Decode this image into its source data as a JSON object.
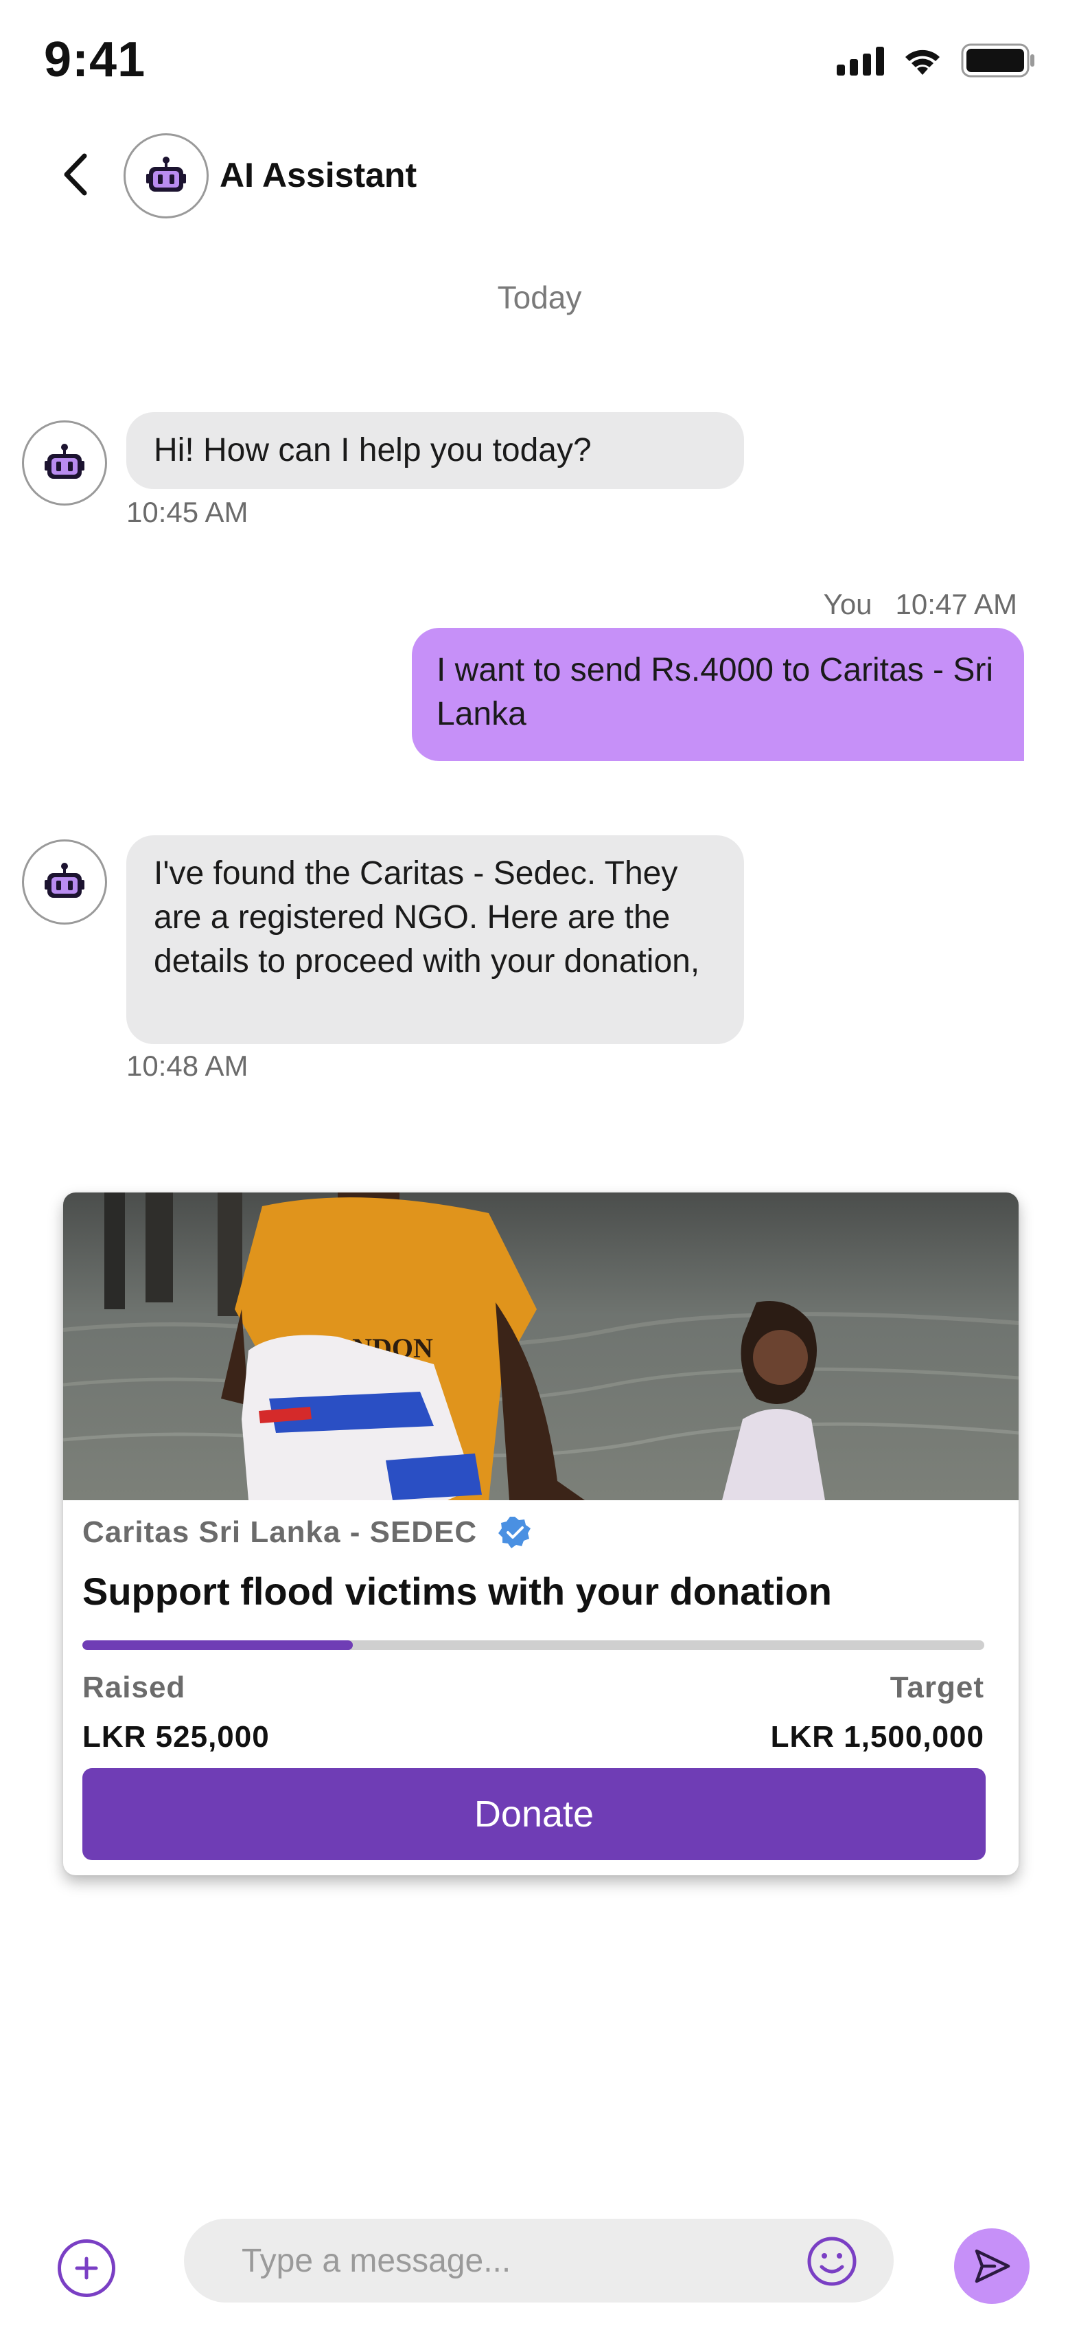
{
  "status_bar": {
    "time": "9:41"
  },
  "header": {
    "title": "AI Assistant"
  },
  "date_separator": "Today",
  "messages": [
    {
      "sender": "bot",
      "text": "Hi! How can I help you today?",
      "time": "10:45 AM"
    },
    {
      "sender": "user",
      "sender_label": "You",
      "text": "I want to send Rs.4000 to Caritas - Sri Lanka",
      "time": "10:47 AM"
    },
    {
      "sender": "bot",
      "text": "I've found the Caritas - Sedec. They are a registered NGO. Here are the details to proceed with your donation,",
      "time": "10:48 AM"
    }
  ],
  "donation_card": {
    "organization": "Caritas Sri Lanka - SEDEC",
    "verified": true,
    "title": "Support flood victims with your donation",
    "progress_fraction": 0.3,
    "raised_label": "Raised",
    "raised_value": "LKR 525,000",
    "target_label": "Target",
    "target_value": "LKR 1,500,000",
    "button_label": "Donate"
  },
  "input_bar": {
    "placeholder": "Type a message..."
  },
  "colors": {
    "accent": "#6f3db5",
    "user_bubble": "#c690f8",
    "bot_bubble": "#e9e9ea",
    "verified_badge": "#4a90e2"
  },
  "icons": [
    "back-arrow-icon",
    "robot-icon",
    "verified-badge-icon",
    "plus-icon",
    "emoji-icon",
    "send-icon",
    "signal-icon",
    "wifi-icon",
    "battery-icon"
  ]
}
